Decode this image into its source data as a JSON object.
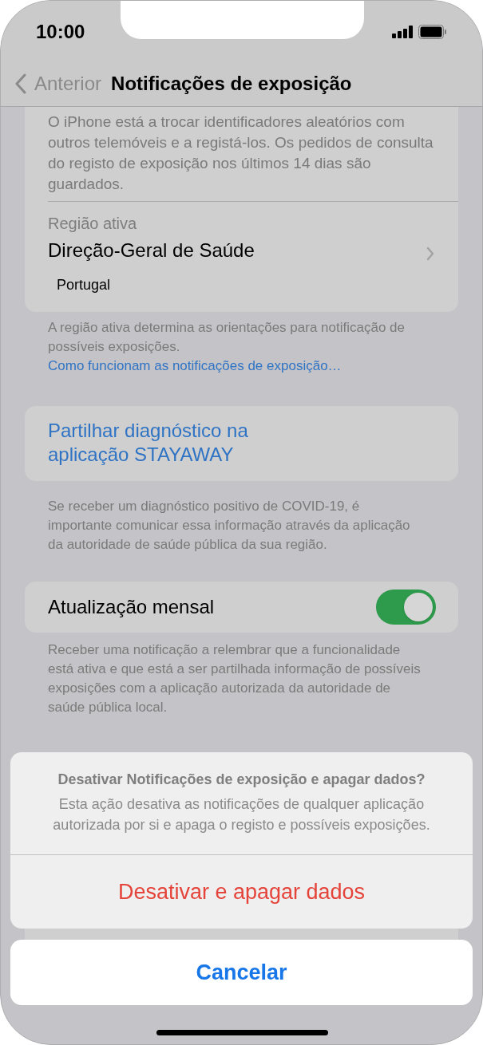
{
  "status_bar": {
    "time": "10:00"
  },
  "nav": {
    "back": "Anterior",
    "title": "Notificações de exposição"
  },
  "status_card": {
    "description": "O iPhone está a trocar identificadores aleatórios com outros telemóveis e a registá-los. Os pedidos de consulta do registo de exposição nos últimos 14 dias são guardados."
  },
  "region": {
    "label": "Região ativa",
    "name": "Direção-Geral de Saúde",
    "country": "Portugal"
  },
  "region_footer": {
    "text": "A região ativa determina as orientações para notificação de possíveis exposições.",
    "link": "Como funcionam as notificações de exposição…"
  },
  "share": {
    "label": "Partilhar diagnóstico na aplicação STAYAWAY",
    "footer": "Se receber um diagnóstico positivo de COVID-19, é importante comunicar essa informação através da aplicação da autoridade de saúde pública da sua região."
  },
  "monthly": {
    "label": "Atualização mensal",
    "on": true,
    "footer": "Receber uma notificação a relembrar que a funcionalidade está ativa e que está a ser partilhada informação de possíveis exposições com a aplicação autorizada da autoridade de saúde pública local."
  },
  "action_sheet": {
    "title": "Desativar Notificações de exposição e apagar dados?",
    "message": "Esta ação desativa as notificações de qualquer aplicação autorizada por si e apaga o registo e possíveis exposições.",
    "actions": [
      {
        "label": "Desativar e apagar dados",
        "kind": "destructive"
      }
    ],
    "cancel": "Cancelar"
  }
}
